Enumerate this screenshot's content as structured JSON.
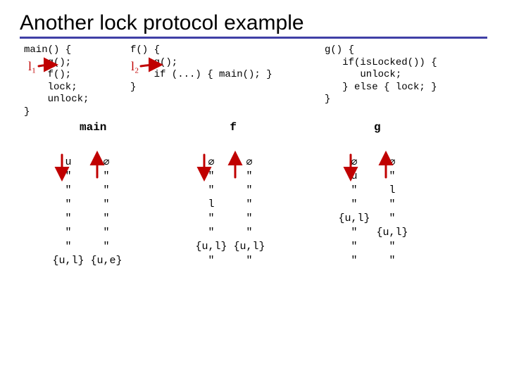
{
  "title": "Another lock protocol example",
  "code": {
    "main": "main() {\n    g();\n    f();\n    lock;\n    unlock;\n}",
    "f": "f() {\n    g();\n    if (...) { main(); }\n}",
    "g": "g() {\n   if(isLocked()) {\n      unlock;\n   } else { lock; }\n}"
  },
  "labels": {
    "main": "main",
    "f": "f",
    "g": "g"
  },
  "symbols": {
    "empty": "∅",
    "ditto": "″"
  },
  "tables": {
    "main": {
      "rows": [
        [
          "u",
          "∅"
        ],
        [
          "″",
          "″"
        ],
        [
          "″",
          "″"
        ],
        [
          "″",
          "″"
        ],
        [
          "″",
          "″"
        ],
        [
          "″",
          "″"
        ],
        [
          "″",
          "″"
        ],
        [
          "{u,l}",
          "{u,e}"
        ]
      ]
    },
    "f": {
      "rows": [
        [
          "∅",
          "∅"
        ],
        [
          "″",
          "″"
        ],
        [
          "″",
          "″"
        ],
        [
          "l",
          "″"
        ],
        [
          "″",
          "″"
        ],
        [
          "″",
          "″"
        ],
        [
          "{u,l}",
          "{u,l}"
        ],
        [
          "″",
          "″"
        ]
      ]
    },
    "g": {
      "rows": [
        [
          "∅",
          "∅"
        ],
        [
          "u",
          "″"
        ],
        [
          "″",
          "l"
        ],
        [
          "″",
          "″"
        ],
        [
          "{u,l}",
          "″"
        ],
        [
          "″",
          "{u,l}"
        ],
        [
          "″",
          "″"
        ],
        [
          "″",
          "″"
        ]
      ]
    }
  }
}
